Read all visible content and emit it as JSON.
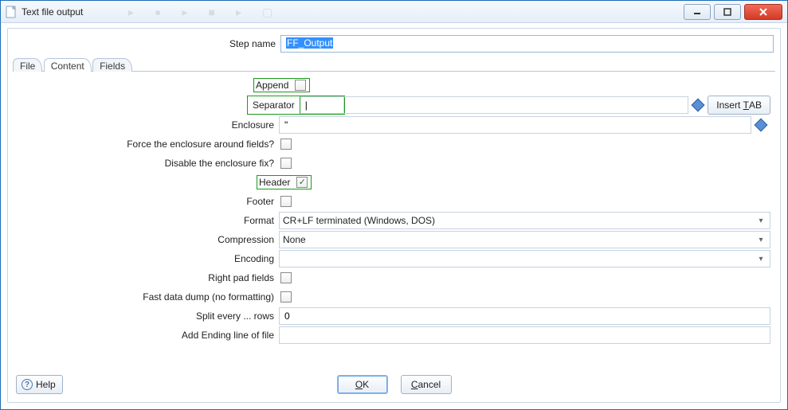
{
  "window": {
    "title": "Text file output"
  },
  "stepname": {
    "label": "Step name",
    "value": "FF_Output"
  },
  "tabs": {
    "file": "File",
    "content": "Content",
    "fields": "Fields"
  },
  "form": {
    "append": {
      "label": "Append",
      "checked": false
    },
    "separator": {
      "label": "Separator",
      "value": "|",
      "insert_tab": "Insert TAB"
    },
    "enclosure": {
      "label": "Enclosure",
      "value": "\""
    },
    "force_enclosure": {
      "label": "Force the enclosure around fields?",
      "checked": false
    },
    "disable_enclosure_fix": {
      "label": "Disable the enclosure fix?",
      "checked": false
    },
    "header": {
      "label": "Header",
      "checked": true
    },
    "footer": {
      "label": "Footer",
      "checked": false
    },
    "format": {
      "label": "Format",
      "value": "CR+LF terminated (Windows, DOS)"
    },
    "compression": {
      "label": "Compression",
      "value": "None"
    },
    "encoding": {
      "label": "Encoding",
      "value": ""
    },
    "right_pad": {
      "label": "Right pad fields",
      "checked": false
    },
    "fast_dump": {
      "label": "Fast data dump (no formatting)",
      "checked": false
    },
    "split_rows": {
      "label": "Split every ... rows",
      "value": "0"
    },
    "ending_line": {
      "label": "Add Ending line of file",
      "value": ""
    }
  },
  "buttons": {
    "ok": "OK",
    "cancel": "Cancel",
    "help": "Help"
  }
}
